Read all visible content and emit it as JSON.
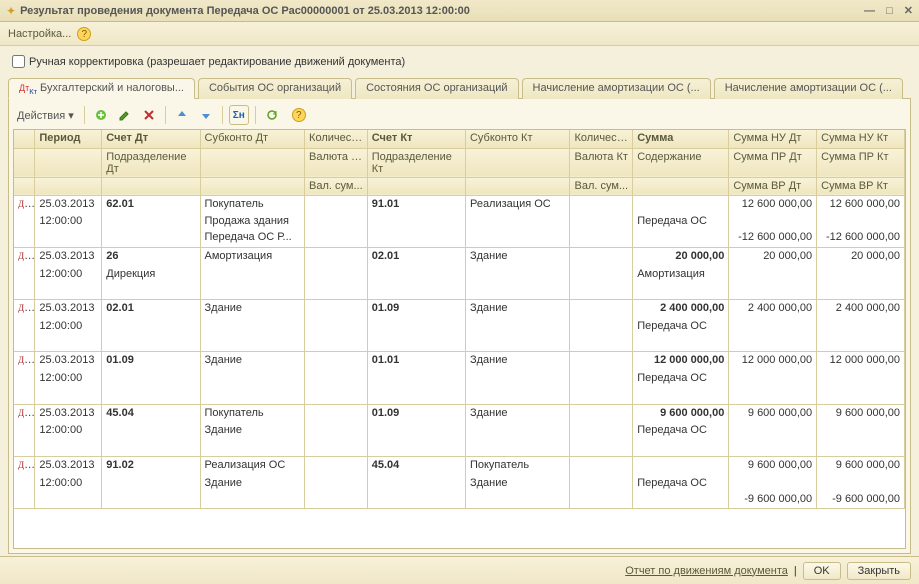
{
  "window": {
    "title": "Результат проведения документа Передача ОС Рас00000001 от 25.03.2013 12:00:00",
    "settings": "Настройка...",
    "manual_edit_label": "Ручная корректировка (разрешает редактирование движений документа)"
  },
  "tabs": [
    "Бухгалтерский и налоговы...",
    "События ОС организаций",
    "Состояния ОС организаций",
    "Начисление амортизации ОС (...",
    "Начисление амортизации ОС (..."
  ],
  "actions_label": "Действия ▾",
  "headers": {
    "r1": [
      "",
      "Период",
      "Счет Дт",
      "Субконто Дт",
      "Количест...",
      "Счет Кт",
      "Субконто Кт",
      "Количест...",
      "Сумма",
      "Сумма НУ Дт",
      "Сумма НУ Кт"
    ],
    "r2": [
      "",
      "",
      "Подразделение Дт",
      "",
      "Валюта Дт",
      "Подразделение Кт",
      "",
      "Валюта Кт",
      "Содержание",
      "Сумма ПР Дт",
      "Сумма ПР Кт"
    ],
    "r3": [
      "",
      "",
      "",
      "",
      "Вал. сум...",
      "",
      "",
      "Вал. сум...",
      "",
      "Сумма ВР Дт",
      "Сумма ВР Кт"
    ]
  },
  "rows": [
    {
      "period1": "25.03.2013",
      "period2": "12:00:00",
      "acc_dt": "62.01",
      "sub_dt1": "Покупатель",
      "sub_dt2": "Продажа здания",
      "sub_dt3": "Передача ОС Р...",
      "acc_kt": "91.01",
      "sub_kt1": "Реализация ОС",
      "sum": "",
      "content": "Передача ОС",
      "nu_dt1": "12 600 000,00",
      "nu_kt1": "12 600 000,00",
      "nu_dt3": "-12 600 000,00",
      "nu_kt3": "-12 600 000,00"
    },
    {
      "period1": "25.03.2013",
      "period2": "12:00:00",
      "acc_dt": "26",
      "acc_dt2": "Дирекция",
      "sub_dt1": "Амортизация",
      "acc_kt": "02.01",
      "sub_kt1": "Здание",
      "sum": "20 000,00",
      "content": "Амортизация",
      "nu_dt1": "20 000,00",
      "nu_kt1": "20 000,00"
    },
    {
      "period1": "25.03.2013",
      "period2": "12:00:00",
      "acc_dt": "02.01",
      "sub_dt1": "Здание",
      "acc_kt": "01.09",
      "sub_kt1": "Здание",
      "sum": "2 400 000,00",
      "content": "Передача ОС",
      "nu_dt1": "2 400 000,00",
      "nu_kt1": "2 400 000,00"
    },
    {
      "period1": "25.03.2013",
      "period2": "12:00:00",
      "acc_dt": "01.09",
      "sub_dt1": "Здание",
      "acc_kt": "01.01",
      "sub_kt1": "Здание",
      "sum": "12 000 000,00",
      "content": "Передача ОС",
      "nu_dt1": "12 000 000,00",
      "nu_kt1": "12 000 000,00"
    },
    {
      "period1": "25.03.2013",
      "period2": "12:00:00",
      "acc_dt": "45.04",
      "sub_dt1": "Покупатель",
      "sub_dt2": "Здание",
      "acc_kt": "01.09",
      "sub_kt1": "Здание",
      "sum": "9 600 000,00",
      "content": "Передача ОС",
      "nu_dt1": "9 600 000,00",
      "nu_kt1": "9 600 000,00"
    },
    {
      "period1": "25.03.2013",
      "period2": "12:00:00",
      "acc_dt": "91.02",
      "sub_dt1": "Реализация ОС",
      "sub_dt2": "Здание",
      "acc_kt": "45.04",
      "sub_kt1": "Покупатель",
      "sub_kt2": "Здание",
      "sum": "",
      "content": "Передача ОС",
      "nu_dt1": "9 600 000,00",
      "nu_kt1": "9 600 000,00",
      "nu_dt3": "-9 600 000,00",
      "nu_kt3": "-9 600 000,00"
    }
  ],
  "footer": {
    "report_link": "Отчет по движениям документа",
    "ok": "OK",
    "close": "Закрыть"
  }
}
